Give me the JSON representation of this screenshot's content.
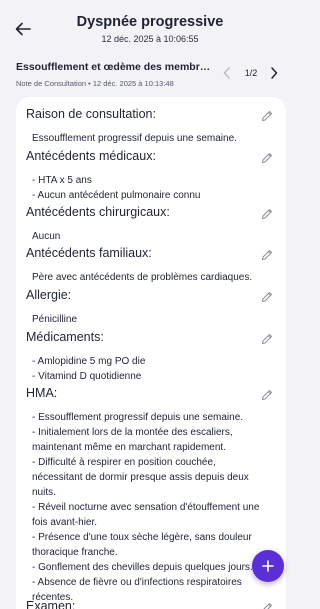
{
  "header": {
    "title": "Dyspnée progressive",
    "datetime": "12 déc. 2025 à 10:06:55"
  },
  "note": {
    "title": "Essoufflement et œdème des membres in...",
    "meta": "Note de Consultation  •  12 déc. 2025 à 10:13:48",
    "pager": "1/2"
  },
  "sections": [
    {
      "title": "Raison de consultation:",
      "lines": [
        "Essoufflement progressif depuis une semaine."
      ]
    },
    {
      "title": "Antécédents médicaux:",
      "lines": [
        "- HTA x 5 ans",
        "- Aucun antécédent pulmonaire connu"
      ]
    },
    {
      "title": "Antécédents chirurgicaux:",
      "lines": [
        "Aucun"
      ]
    },
    {
      "title": "Antécédents familiaux:",
      "lines": [
        "Père avec antécédents de problèmes cardiaques."
      ]
    },
    {
      "title": "Allergie:",
      "lines": [
        "Pénicilline"
      ]
    },
    {
      "title": "Médicaments:",
      "lines": [
        "- Amlopidine 5 mg PO die",
        "- Vitamind D quotidienne"
      ]
    },
    {
      "title": "HMA:",
      "lines": [
        "- Essoufflement progressif depuis une semaine.",
        "- Initialement lors de la montée des escaliers,",
        "maintenant même en marchant rapidement.",
        "- Difficulté à respirer en position couchée,",
        "nécessitant de dormir presque assis depuis deux",
        "nuits.",
        "- Réveil nocturne avec sensation d'étouffement une",
        "fois avant-hier.",
        "- Présence d'une toux sèche légère, sans douleur",
        "thoracique franche.",
        "- Gonflement des chevilles depuis quelques jours.",
        "- Absence de fièvre ou d'infections respiratoires",
        "récentes."
      ]
    },
    {
      "title": "Examen:",
      "lines": []
    }
  ],
  "icons": {
    "back": "arrow-left-icon",
    "prev": "chevron-left-icon",
    "next": "chevron-right-icon",
    "edit": "pencil-icon",
    "add": "plus-icon"
  },
  "colors": {
    "background": "#f2f2f7",
    "card": "#ffffff",
    "text": "#1f2433",
    "fab": "#5b2fd6",
    "icon_muted": "#8a8f99",
    "pager_disabled": "#b8bcc4"
  }
}
